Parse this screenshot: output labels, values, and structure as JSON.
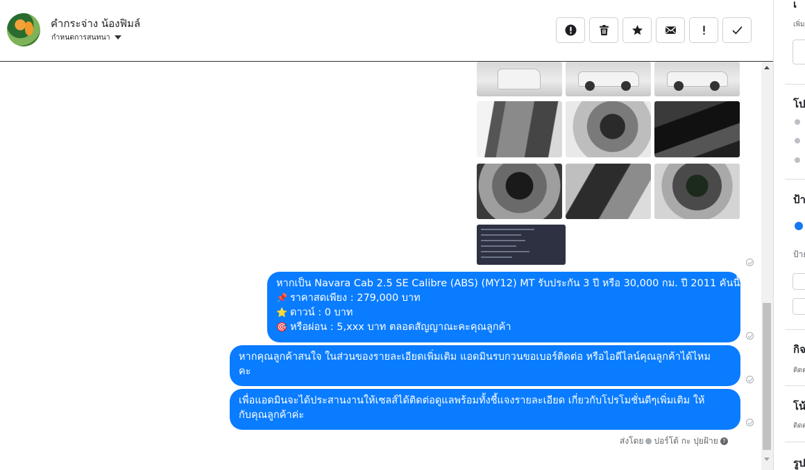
{
  "header": {
    "contact_name": "คำกระจ่าง น้องฟิมล์",
    "assign_label": "กำหนดการสนทนา",
    "actions": [
      {
        "name": "report-button",
        "icon": "alert-circle-icon"
      },
      {
        "name": "delete-button",
        "icon": "trash-icon"
      },
      {
        "name": "star-button",
        "icon": "star-icon"
      },
      {
        "name": "mail-button",
        "icon": "envelope-icon"
      },
      {
        "name": "mark-important-button",
        "icon": "exclamation-icon"
      },
      {
        "name": "done-button",
        "icon": "check-icon"
      }
    ]
  },
  "messages": [
    {
      "lines": [
        "หากเป็น Navara Cab 2.5 SE Calibre (ABS) (MY12) MT รับประกัน 3 ปี หรือ 30,000 กม. ปี 2011 คันนี้",
        "ราคาสดเพียง : 279,000 บาท",
        "ดาวน์ : 0 บาท",
        "หรือผ่อน : 5,xxx บาท ตลอดสัญญาณะคะคุณลูกค้า"
      ],
      "emojis": [
        "📌",
        "⭐",
        "🎯"
      ]
    },
    {
      "lines": [
        "หากคุณลูกค้าสนใจ ในส่วนของรายละเอียดเพิ่มเติม แอดมินรบกวนขอเบอร์ติดต่อ หรือไอดีไลน์คุณลูกค้าได้ไหม",
        "คะ"
      ]
    },
    {
      "lines": [
        "เพื่อแอดมินจะได้ประสานงานให้เซลส์ได้ติดต่อดูแลพร้อมทั้งชี้แจงรายละเอียด เกี่ยวกับโปรโมชั่นดีๆเพิ่มเติม ให้",
        "กับคุณลูกค้าค่ะ"
      ]
    }
  ],
  "sent_by": {
    "prefix": "ส่งโดย",
    "name": "ปอร์โต้ กะ ปุยฝ้าย",
    "help": "?"
  },
  "right_panel": {
    "labels": [
      "เ",
      "เพิ่ม",
      "โป",
      "ป้า",
      "ป้าย",
      "กิจ",
      "ติดต",
      "โน้",
      "ติดต",
      "รูป"
    ]
  },
  "colors": {
    "bubble": "#0a7cff",
    "header_border": "#2f2f2f",
    "muted_text": "#65676b"
  }
}
